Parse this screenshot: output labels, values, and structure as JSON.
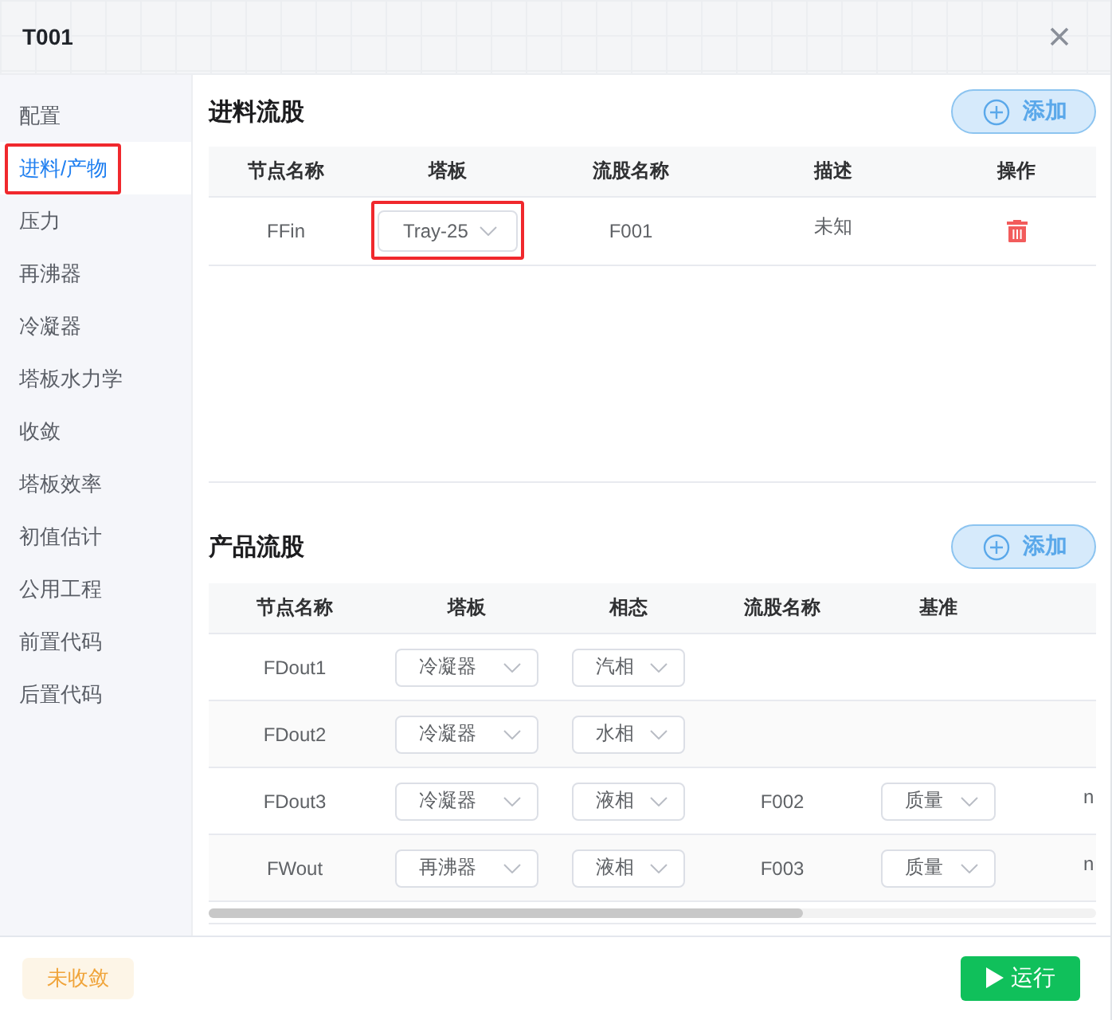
{
  "window": {
    "title": "T001"
  },
  "sidebar": {
    "items": [
      {
        "label": "配置",
        "selected": false,
        "annotated": false
      },
      {
        "label": "进料/产物",
        "selected": true,
        "annotated": true
      },
      {
        "label": "压力",
        "selected": false,
        "annotated": false
      },
      {
        "label": "再沸器",
        "selected": false,
        "annotated": false
      },
      {
        "label": "冷凝器",
        "selected": false,
        "annotated": false
      },
      {
        "label": "塔板水力学",
        "selected": false,
        "annotated": false
      },
      {
        "label": "收敛",
        "selected": false,
        "annotated": false
      },
      {
        "label": "塔板效率",
        "selected": false,
        "annotated": false
      },
      {
        "label": "初值估计",
        "selected": false,
        "annotated": false
      },
      {
        "label": "公用工程",
        "selected": false,
        "annotated": false
      },
      {
        "label": "前置代码",
        "selected": false,
        "annotated": false
      },
      {
        "label": "后置代码",
        "selected": false,
        "annotated": false
      }
    ]
  },
  "feed_section": {
    "title": "进料流股",
    "add_button": "添加",
    "table": {
      "columns": [
        "节点名称",
        "塔板",
        "流股名称",
        "描述",
        "操作"
      ],
      "rows": [
        {
          "node": "FFin",
          "tray": {
            "value": "Tray-25",
            "annotated": true
          },
          "stream": "F001",
          "description": "未知"
        }
      ]
    }
  },
  "product_section": {
    "title": "产品流股",
    "add_button": "添加",
    "table": {
      "columns": [
        "节点名称",
        "塔板",
        "相态",
        "流股名称",
        "基准"
      ],
      "rows": [
        {
          "node": "FDout1",
          "tray": "冷凝器",
          "phase": "汽相"
        },
        {
          "node": "FDout2",
          "tray": "冷凝器",
          "phase": "水相"
        },
        {
          "node": "FDout3",
          "tray": "冷凝器",
          "phase": "液相",
          "stream": "F002",
          "basis": "质量",
          "column_6": "n"
        },
        {
          "node": "FWout",
          "tray": "再沸器",
          "phase": "液相",
          "stream": "F003",
          "basis": "质量",
          "column_6": "n"
        }
      ]
    }
  },
  "footer": {
    "status": {
      "label": "未收敛",
      "kind": "warning"
    },
    "run_button": "运行"
  }
}
